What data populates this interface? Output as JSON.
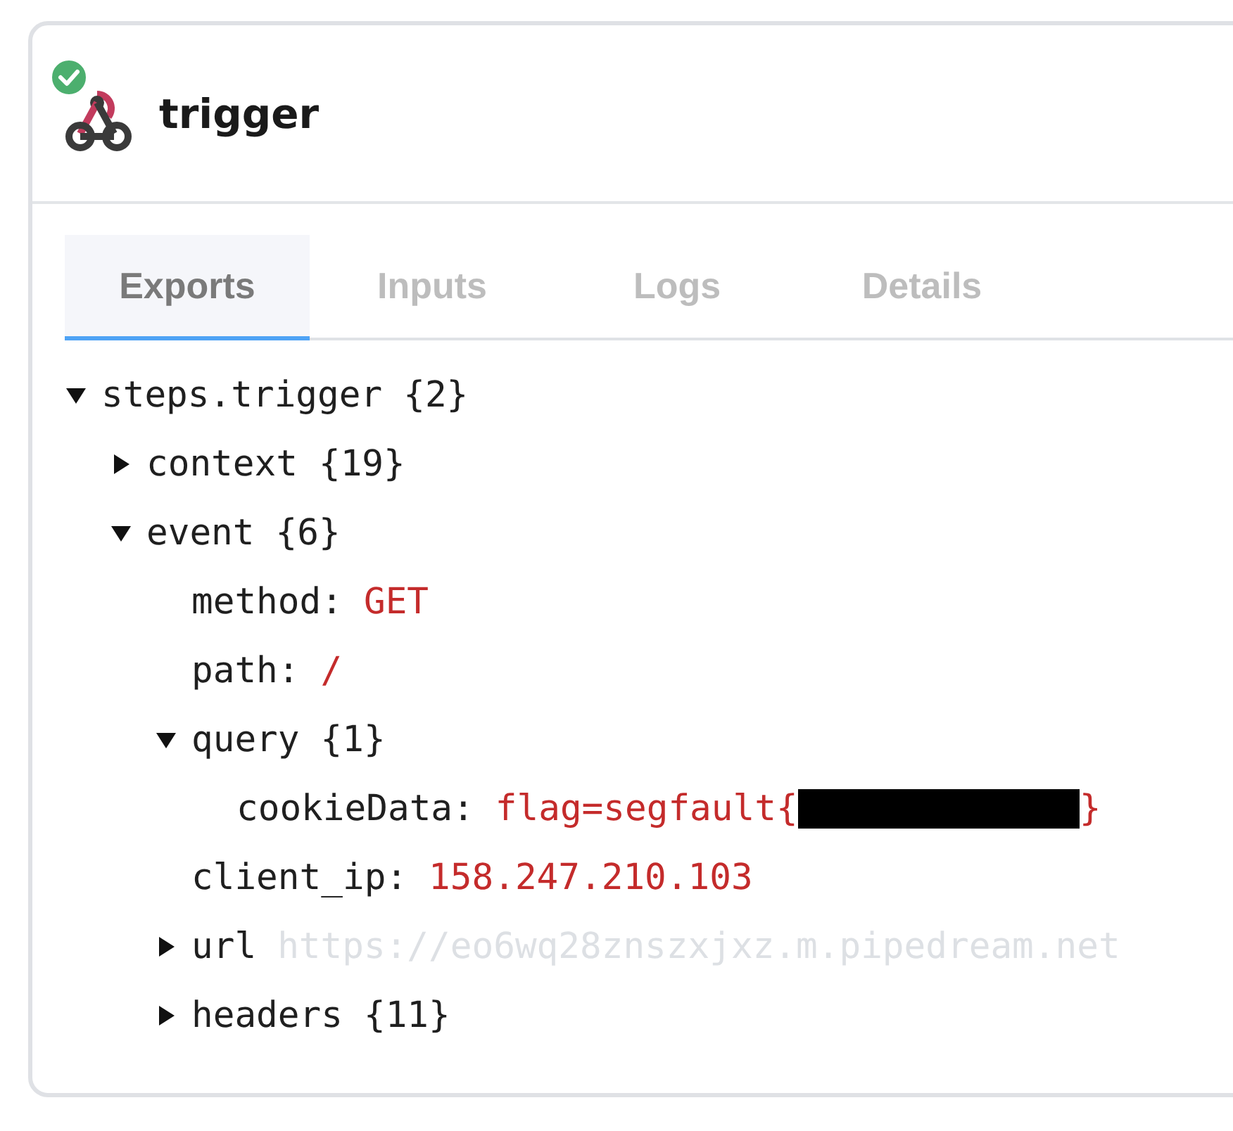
{
  "step": {
    "title": "trigger",
    "succeeded": true
  },
  "tabs": [
    {
      "label": "Exports",
      "selected": true
    },
    {
      "label": "Inputs",
      "selected": false
    },
    {
      "label": "Logs",
      "selected": false
    },
    {
      "label": "Details",
      "selected": false
    }
  ],
  "tree": [
    {
      "key": "steps.trigger",
      "count": "{2}",
      "expanded": true,
      "children": [
        {
          "key": "context",
          "count": "{19}",
          "expanded": false
        },
        {
          "key": "event",
          "count": "{6}",
          "expanded": true,
          "children": [
            {
              "key": "method:",
              "value": "GET"
            },
            {
              "key": "path:",
              "value": "/"
            },
            {
              "key": "query",
              "count": "{1}",
              "expanded": true,
              "children": [
                {
                  "key": "cookieData:",
                  "value": "flag=segfault{",
                  "redacted": true,
                  "value_end": "}"
                }
              ]
            },
            {
              "key": "client_ip:",
              "value": "158.247.210.103"
            },
            {
              "key": "url",
              "preview": "https://eo6wq28znszxjxz.m.pipedream.net",
              "expanded": false
            },
            {
              "key": "headers",
              "count": "{11}",
              "expanded": false
            }
          ]
        }
      ]
    }
  ]
}
